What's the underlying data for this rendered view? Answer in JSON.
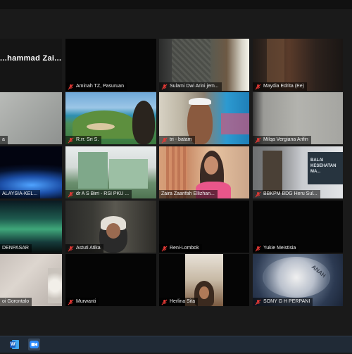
{
  "participants": [
    {
      "name": "...hammad  Zai...",
      "muted": false
    },
    {
      "name": "Aminah TZ, Pasuruan",
      "muted": true
    },
    {
      "name": "Sulami Dwi Arini jem...",
      "muted": true
    },
    {
      "name": "Maydia Edrita (Ee)",
      "muted": true
    },
    {
      "name": "a",
      "muted": true
    },
    {
      "name": "R.rr. Sri S.",
      "muted": true
    },
    {
      "name": "tri - batam",
      "muted": true
    },
    {
      "name": "Milqa Vergiana Arifin",
      "muted": true
    },
    {
      "name": "ALAYSIA-KEL...",
      "muted": false
    },
    {
      "name": "dr A S Birri - RSI PKU ...",
      "muted": true
    },
    {
      "name": "Zaira Zaarifah Ellizhan...",
      "muted": false
    },
    {
      "name": "BBKPM BDG Heru Sul...",
      "muted": true
    },
    {
      "name": "DENPASAR",
      "muted": false
    },
    {
      "name": "Astuti Atika",
      "muted": true
    },
    {
      "name": "Reni-Lombok",
      "muted": true
    },
    {
      "name": "Yukie Meistisia",
      "muted": true
    },
    {
      "name": "oi Gorontalo",
      "muted": false
    },
    {
      "name": "Murwanti",
      "muted": true
    },
    {
      "name": "Herlina Sita",
      "muted": true
    },
    {
      "name": "SONY G H PERPANI",
      "muted": true
    }
  ],
  "video_text": {
    "banner_text": "BALAI KESEHATAN MA...",
    "coin_text": "ANAH"
  },
  "taskbar": {
    "icons": [
      "word-icon",
      "zoom-icon"
    ],
    "word_letter": "W"
  },
  "colors": {
    "active_outline": "#8bc34a",
    "muted_icon": "#e53935",
    "taskbar_bg": "#202a36"
  }
}
